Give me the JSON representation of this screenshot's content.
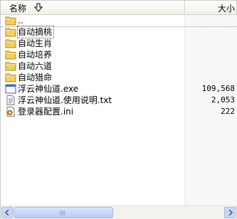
{
  "header": {
    "name_label": "名称",
    "size_label": "大小"
  },
  "rows": [
    {
      "name": "..",
      "size": "",
      "icon": "folder-up-icon"
    },
    {
      "name": "自动摘桃",
      "size": "",
      "icon": "folder-icon"
    },
    {
      "name": "自动生肖",
      "size": "",
      "icon": "folder-icon"
    },
    {
      "name": "自动培养",
      "size": "",
      "icon": "folder-icon"
    },
    {
      "name": "自动六道",
      "size": "",
      "icon": "folder-icon"
    },
    {
      "name": "自动猎命",
      "size": "",
      "icon": "folder-icon"
    },
    {
      "name": "浮云神仙道.exe",
      "size": "109,568",
      "icon": "exe-icon"
    },
    {
      "name": "浮云神仙道.使用说明.txt",
      "size": "2,053",
      "icon": "txt-icon"
    },
    {
      "name": "登录器配置.ini",
      "size": "222",
      "icon": "ini-icon"
    }
  ],
  "colors": {
    "folder": "#f4cf5a",
    "scroll_accent": "#b9cdf6"
  }
}
